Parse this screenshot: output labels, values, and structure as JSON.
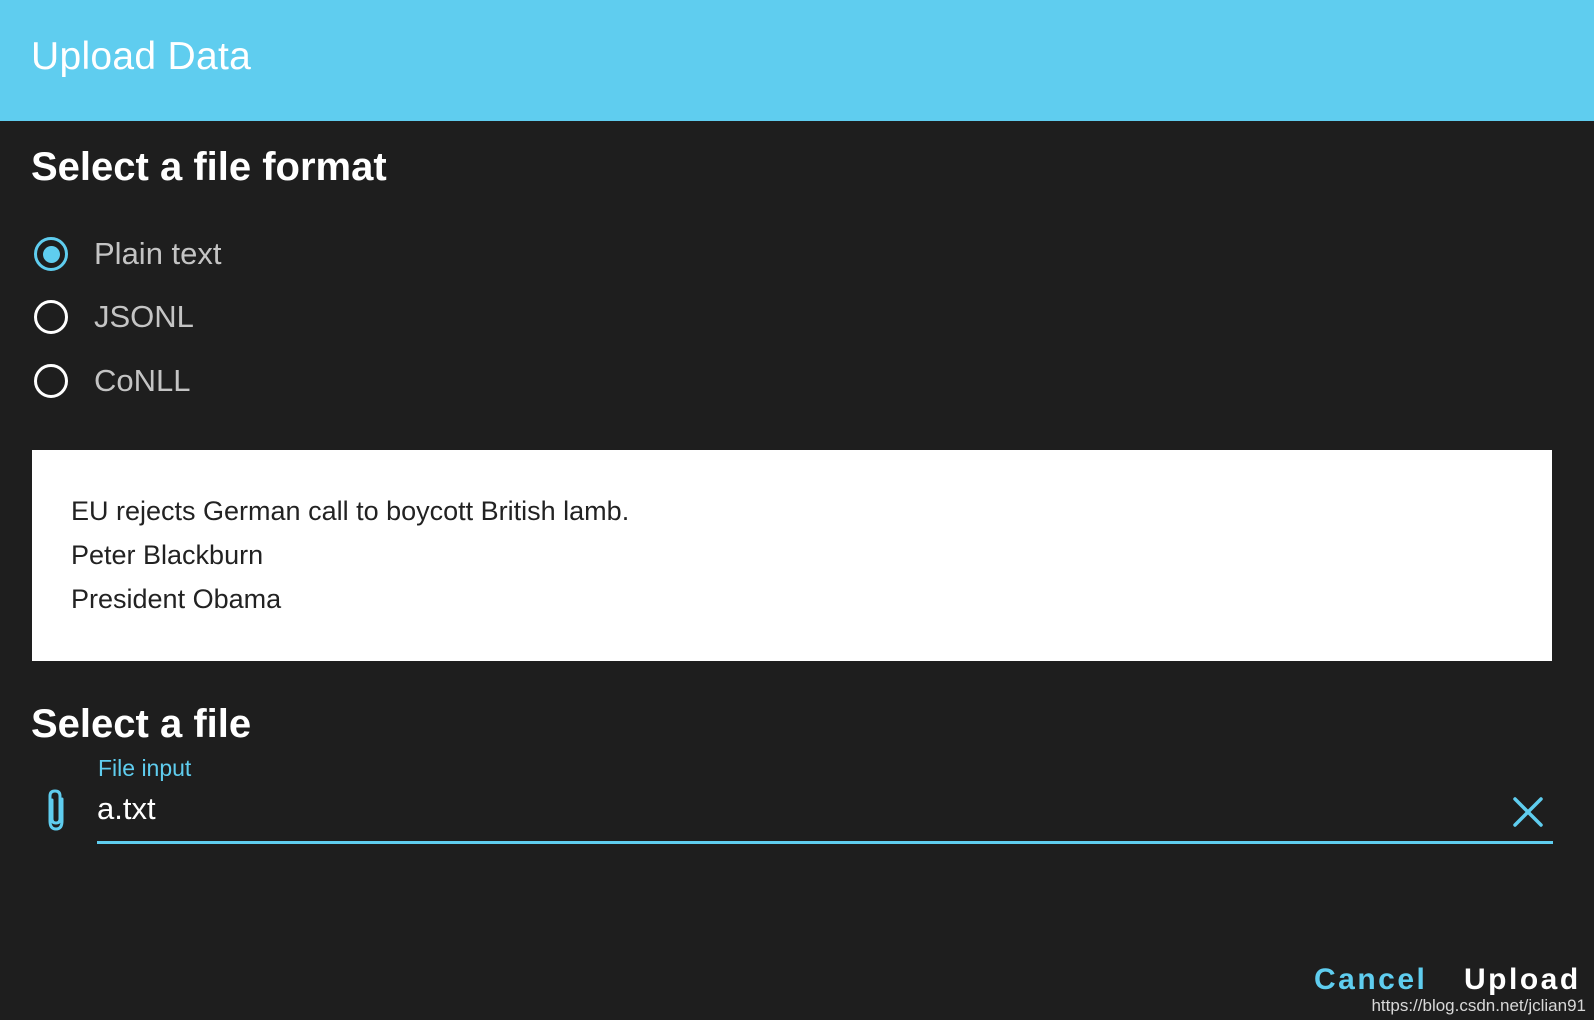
{
  "dialog": {
    "title": "Upload Data"
  },
  "format_section": {
    "heading": "Select a file format",
    "options": [
      {
        "label": "Plain text",
        "selected": true
      },
      {
        "label": "JSONL",
        "selected": false
      },
      {
        "label": "CoNLL",
        "selected": false
      }
    ]
  },
  "example": {
    "lines": [
      "EU rejects German call to boycott British lamb.",
      "Peter Blackburn",
      "President Obama"
    ]
  },
  "file_section": {
    "heading": "Select a file",
    "input_label": "File input",
    "input_value": "a.txt"
  },
  "actions": {
    "cancel_label": "Cancel",
    "upload_label": "Upload"
  },
  "watermark": "https://blog.csdn.net/jclian91",
  "colors": {
    "accent": "#5fcdef",
    "background": "#1e1e1e",
    "example_bg": "#ffffff"
  },
  "icons": {
    "attach": "paperclip-icon",
    "clear": "close-icon"
  }
}
